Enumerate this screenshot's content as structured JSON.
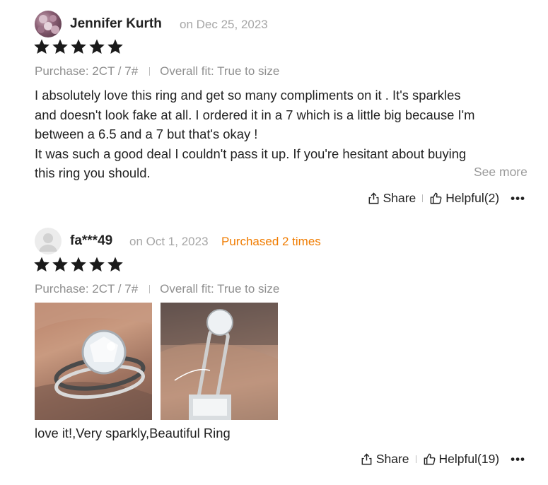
{
  "reviews": [
    {
      "name": "Jennifer Kurth",
      "date": "on Dec 25, 2023",
      "rating": 5,
      "purchase": "Purchase: 2CT / 7#",
      "fit": "Overall fit: True to size",
      "text_lines": [
        "I absolutely love this ring and get so many compliments on it . It's sparkles",
        "and doesn't look fake at all. I ordered it in a 7 which is a little big because I'm",
        "between a 6.5 and a 7 but that's okay !",
        "It was such a good deal I couldn't pass it up. If you're hesitant about buying",
        "this ring you should."
      ],
      "see_more": "See more",
      "share": "Share",
      "helpful": "Helpful(2)",
      "more": "•••"
    },
    {
      "name": "fa***49",
      "date": "on Oct 1, 2023",
      "purchased": "Purchased 2 times",
      "rating": 5,
      "purchase": "Purchase: 2CT / 7#",
      "fit": "Overall fit: True to size",
      "caption": "love it!,Very sparkly,Beautiful Ring",
      "share": "Share",
      "helpful": "Helpful(19)",
      "more": "•••"
    }
  ],
  "colors": {
    "accent_orange": "#f07c00",
    "muted_text": "#8f8f8f",
    "date_text": "#a6a6a6"
  }
}
